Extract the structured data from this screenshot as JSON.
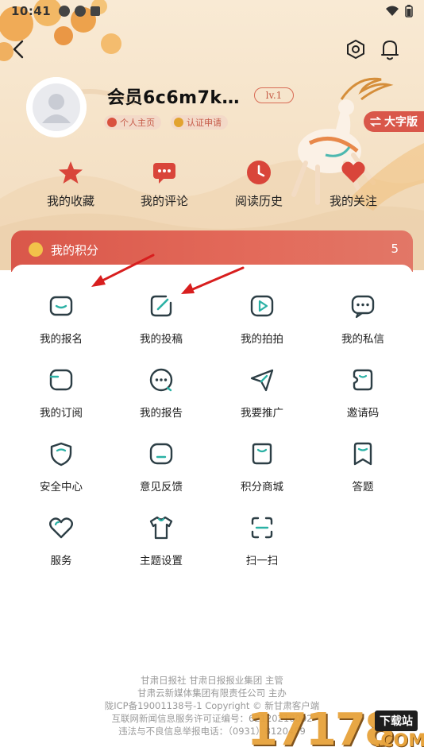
{
  "status_bar": {
    "time": "10:41"
  },
  "profile": {
    "username": "会员6c6m7k…",
    "level": "lv.1",
    "chips": [
      "个人主页",
      "认证申请"
    ],
    "big_font_label": "大字版"
  },
  "quick_actions": [
    {
      "label": "我的收藏",
      "icon": "star-icon"
    },
    {
      "label": "我的评论",
      "icon": "comment-icon"
    },
    {
      "label": "阅读历史",
      "icon": "clock-icon"
    },
    {
      "label": "我的关注",
      "icon": "heart-icon"
    }
  ],
  "points": {
    "label": "我的积分",
    "count": "5"
  },
  "grid": [
    {
      "label": "我的报名",
      "icon": "signup-icon"
    },
    {
      "label": "我的投稿",
      "icon": "edit-icon"
    },
    {
      "label": "我的拍拍",
      "icon": "video-icon"
    },
    {
      "label": "我的私信",
      "icon": "message-icon"
    },
    {
      "label": "我的订阅",
      "icon": "subscribe-icon"
    },
    {
      "label": "我的报告",
      "icon": "report-icon"
    },
    {
      "label": "我要推广",
      "icon": "send-icon"
    },
    {
      "label": "邀请码",
      "icon": "invite-icon"
    },
    {
      "label": "安全中心",
      "icon": "shield-icon"
    },
    {
      "label": "意见反馈",
      "icon": "feedback-icon"
    },
    {
      "label": "积分商城",
      "icon": "shop-icon"
    },
    {
      "label": "答题",
      "icon": "quiz-icon"
    },
    {
      "label": "服务",
      "icon": "service-heart-icon"
    },
    {
      "label": "主题设置",
      "icon": "shirt-icon"
    },
    {
      "label": "扫一扫",
      "icon": "scan-icon"
    }
  ],
  "footer": {
    "line1": "甘肃日报社  甘肃日报报业集团  主管",
    "line2": "甘肃云新媒体集团有限责任公司  主办",
    "line3": "陇ICP备19001138号-1   Copyright  ©  新甘肃客户端",
    "line4": "互联网新闻信息服务许可证编号：62120210002",
    "line5": "违法与不良信息举报电话：（0931）8120459"
  },
  "watermark": {
    "number": "17178",
    "download": "下载站",
    "domain": ".COM"
  },
  "colors": {
    "accent": "#d9574a",
    "teal": "#2bb1a5",
    "icon_dark": "#2c3e45",
    "coin": "#f2c24a"
  }
}
